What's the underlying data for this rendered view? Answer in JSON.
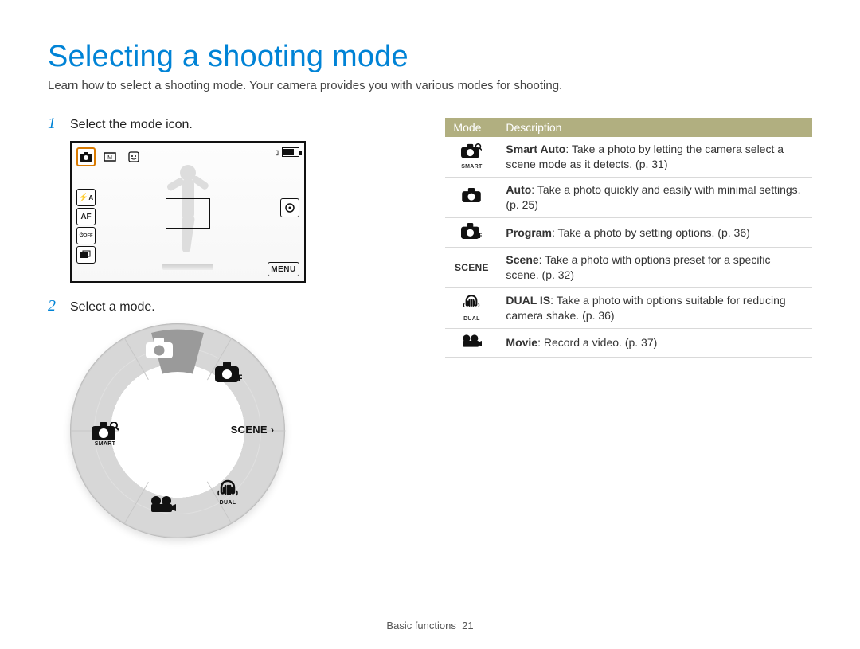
{
  "title": "Selecting a shooting mode",
  "subtitle": "Learn how to select a shooting mode. Your camera provides you with various modes for shooting.",
  "steps": {
    "one_num": "1",
    "one_text": "Select the mode icon.",
    "two_num": "2",
    "two_text": "Select a mode."
  },
  "camera_screen": {
    "top_icons": [
      "camera-icon",
      "aspect-icon",
      "face-icon"
    ],
    "selected_top_index": 0,
    "side_icons": [
      "flash-auto-icon",
      "af-icon",
      "timer-off-icon",
      "burst-icon"
    ],
    "right_icon": "target-icon",
    "menu_label": "MENU",
    "side_labels": {
      "flash": "A",
      "af": "AF",
      "timer": "OFF"
    }
  },
  "mode_wheel": {
    "selected": "auto",
    "scene_label": "SCENE  ›",
    "smart_sub": "SMART",
    "dual_sub": "DUAL"
  },
  "table": {
    "headers": {
      "mode": "Mode",
      "desc": "Description"
    },
    "rows": [
      {
        "icon": "smart-auto-icon",
        "icon_sub": "SMART",
        "name": "Smart Auto",
        "desc": ": Take a photo by letting the camera select a scene mode as it detects. (p. 31)"
      },
      {
        "icon": "auto-icon",
        "icon_sub": "",
        "name": "Auto",
        "desc": ": Take a photo quickly and easily with minimal settings. (p. 25)"
      },
      {
        "icon": "program-icon",
        "icon_sub": "",
        "name": "Program",
        "desc": ": Take a photo by setting options. (p. 36)"
      },
      {
        "icon": "scene-icon",
        "icon_sub": "",
        "name": "Scene",
        "desc": ": Take a photo with options preset for a specific scene. (p. 32)"
      },
      {
        "icon": "dual-is-icon",
        "icon_sub": "DUAL",
        "name": "DUAL IS",
        "desc": ": Take a photo with options suitable for reducing camera shake. (p. 36)"
      },
      {
        "icon": "movie-icon",
        "icon_sub": "",
        "name": "Movie",
        "desc": ": Record a video. (p. 37)"
      }
    ],
    "scene_text": "SCENE"
  },
  "footer": {
    "section": "Basic functions",
    "page": "21"
  }
}
